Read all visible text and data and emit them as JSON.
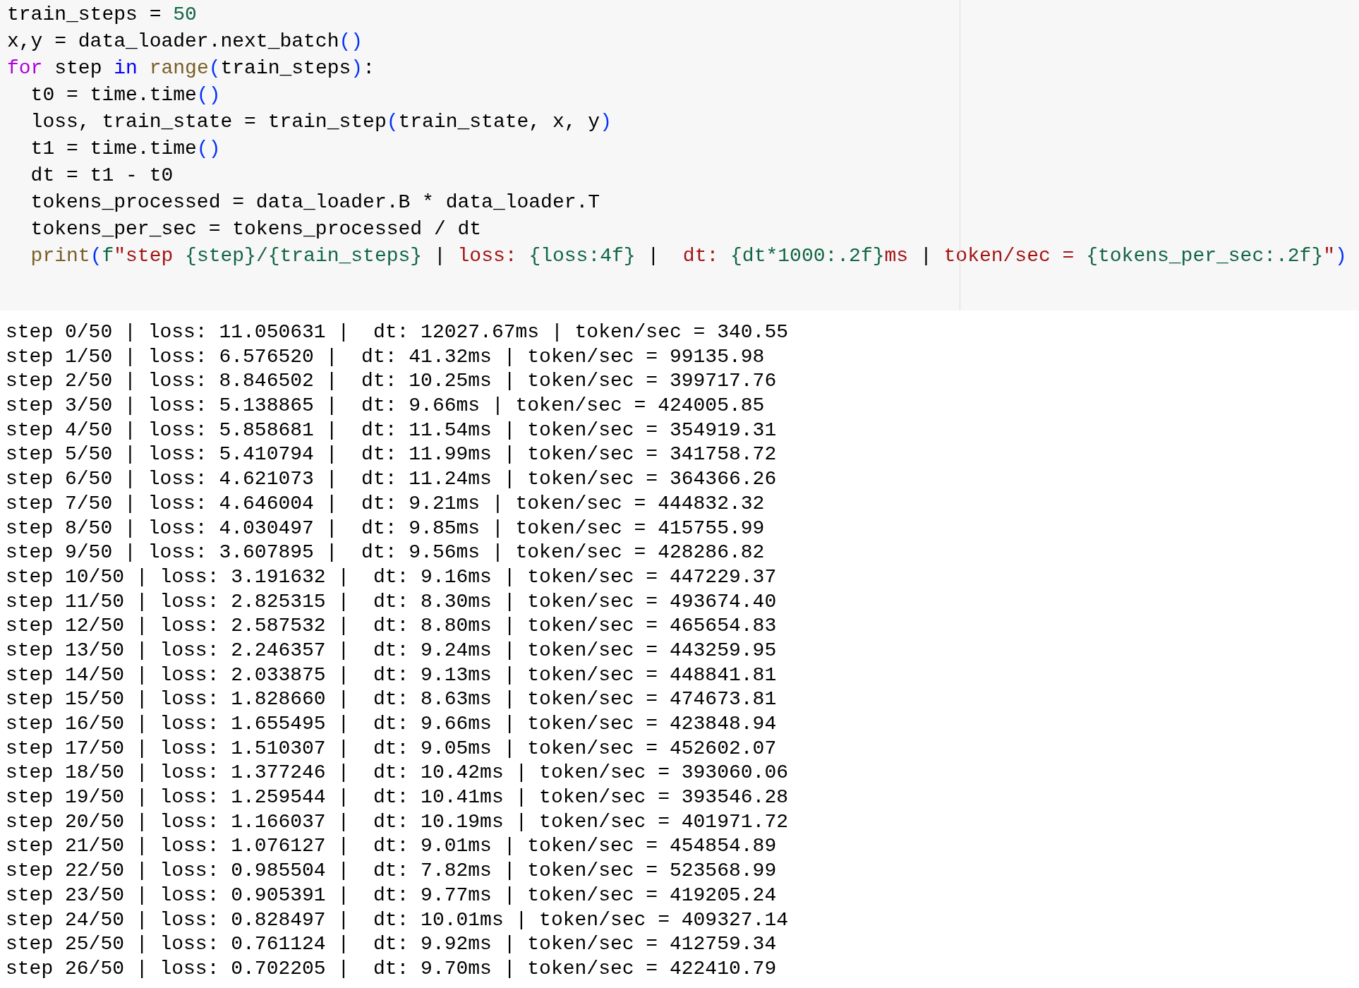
{
  "code_cell": {
    "lines": [
      [
        {
          "kind": "plain",
          "text": "train_steps = "
        },
        {
          "kind": "number",
          "text": "50"
        }
      ],
      [
        {
          "kind": "plain",
          "text": "x,y = data_loader.next_batch"
        },
        {
          "kind": "bracket",
          "text": "()"
        }
      ],
      [
        {
          "kind": "keyword",
          "text": "for"
        },
        {
          "kind": "plain",
          "text": " step "
        },
        {
          "kind": "operator",
          "text": "in "
        },
        {
          "kind": "builtin",
          "text": "range"
        },
        {
          "kind": "bracket",
          "text": "("
        },
        {
          "kind": "plain",
          "text": "train_steps"
        },
        {
          "kind": "bracket",
          "text": ")"
        },
        {
          "kind": "plain",
          "text": ":"
        }
      ],
      [
        {
          "kind": "plain",
          "text": "  t0 = time.time"
        },
        {
          "kind": "bracket",
          "text": "()"
        }
      ],
      [
        {
          "kind": "plain",
          "text": "  loss, train_state = train_step"
        },
        {
          "kind": "bracket",
          "text": "("
        },
        {
          "kind": "plain",
          "text": "train_state, x, y"
        },
        {
          "kind": "bracket",
          "text": ")"
        }
      ],
      [
        {
          "kind": "plain",
          "text": "  t1 = time.time"
        },
        {
          "kind": "bracket",
          "text": "()"
        }
      ],
      [
        {
          "kind": "plain",
          "text": "  dt = t1 - t0"
        }
      ],
      [
        {
          "kind": "plain",
          "text": "  tokens_processed = data_loader.B * data_loader.T"
        }
      ],
      [
        {
          "kind": "plain",
          "text": "  tokens_per_sec = tokens_processed / dt"
        }
      ],
      [
        {
          "kind": "builtin",
          "text": "  print"
        },
        {
          "kind": "bracket",
          "text": "("
        },
        {
          "kind": "interp",
          "text": "f"
        },
        {
          "kind": "string",
          "text": "\"step "
        },
        {
          "kind": "interp",
          "text": "{step}/{train_steps}"
        },
        {
          "kind": "plain",
          "text": " | "
        },
        {
          "kind": "string",
          "text": "loss: "
        },
        {
          "kind": "interp",
          "text": "{loss:4f}"
        },
        {
          "kind": "plain",
          "text": " |  "
        },
        {
          "kind": "string",
          "text": "dt: "
        },
        {
          "kind": "interp",
          "text": "{dt*1000:.2f}"
        },
        {
          "kind": "string",
          "text": "ms"
        },
        {
          "kind": "plain",
          "text": " | "
        },
        {
          "kind": "string",
          "text": "token/sec = "
        },
        {
          "kind": "interp",
          "text": "{tokens_per_sec:.2f}"
        },
        {
          "kind": "string",
          "text": "\""
        },
        {
          "kind": "bracket",
          "text": ")"
        }
      ]
    ]
  },
  "output": [
    "step 0/50 | loss: 11.050631 |  dt: 12027.67ms | token/sec = 340.55",
    "step 1/50 | loss: 6.576520 |  dt: 41.32ms | token/sec = 99135.98",
    "step 2/50 | loss: 8.846502 |  dt: 10.25ms | token/sec = 399717.76",
    "step 3/50 | loss: 5.138865 |  dt: 9.66ms | token/sec = 424005.85",
    "step 4/50 | loss: 5.858681 |  dt: 11.54ms | token/sec = 354919.31",
    "step 5/50 | loss: 5.410794 |  dt: 11.99ms | token/sec = 341758.72",
    "step 6/50 | loss: 4.621073 |  dt: 11.24ms | token/sec = 364366.26",
    "step 7/50 | loss: 4.646004 |  dt: 9.21ms | token/sec = 444832.32",
    "step 8/50 | loss: 4.030497 |  dt: 9.85ms | token/sec = 415755.99",
    "step 9/50 | loss: 3.607895 |  dt: 9.56ms | token/sec = 428286.82",
    "step 10/50 | loss: 3.191632 |  dt: 9.16ms | token/sec = 447229.37",
    "step 11/50 | loss: 2.825315 |  dt: 8.30ms | token/sec = 493674.40",
    "step 12/50 | loss: 2.587532 |  dt: 8.80ms | token/sec = 465654.83",
    "step 13/50 | loss: 2.246357 |  dt: 9.24ms | token/sec = 443259.95",
    "step 14/50 | loss: 2.033875 |  dt: 9.13ms | token/sec = 448841.81",
    "step 15/50 | loss: 1.828660 |  dt: 8.63ms | token/sec = 474673.81",
    "step 16/50 | loss: 1.655495 |  dt: 9.66ms | token/sec = 423848.94",
    "step 17/50 | loss: 1.510307 |  dt: 9.05ms | token/sec = 452602.07",
    "step 18/50 | loss: 1.377246 |  dt: 10.42ms | token/sec = 393060.06",
    "step 19/50 | loss: 1.259544 |  dt: 10.41ms | token/sec = 393546.28",
    "step 20/50 | loss: 1.166037 |  dt: 10.19ms | token/sec = 401971.72",
    "step 21/50 | loss: 1.076127 |  dt: 9.01ms | token/sec = 454854.89",
    "step 22/50 | loss: 0.985504 |  dt: 7.82ms | token/sec = 523568.99",
    "step 23/50 | loss: 0.905391 |  dt: 9.77ms | token/sec = 419205.24",
    "step 24/50 | loss: 0.828497 |  dt: 10.01ms | token/sec = 409327.14",
    "step 25/50 | loss: 0.761124 |  dt: 9.92ms | token/sec = 412759.34",
    "step 26/50 | loss: 0.702205 |  dt: 9.70ms | token/sec = 422410.79"
  ]
}
